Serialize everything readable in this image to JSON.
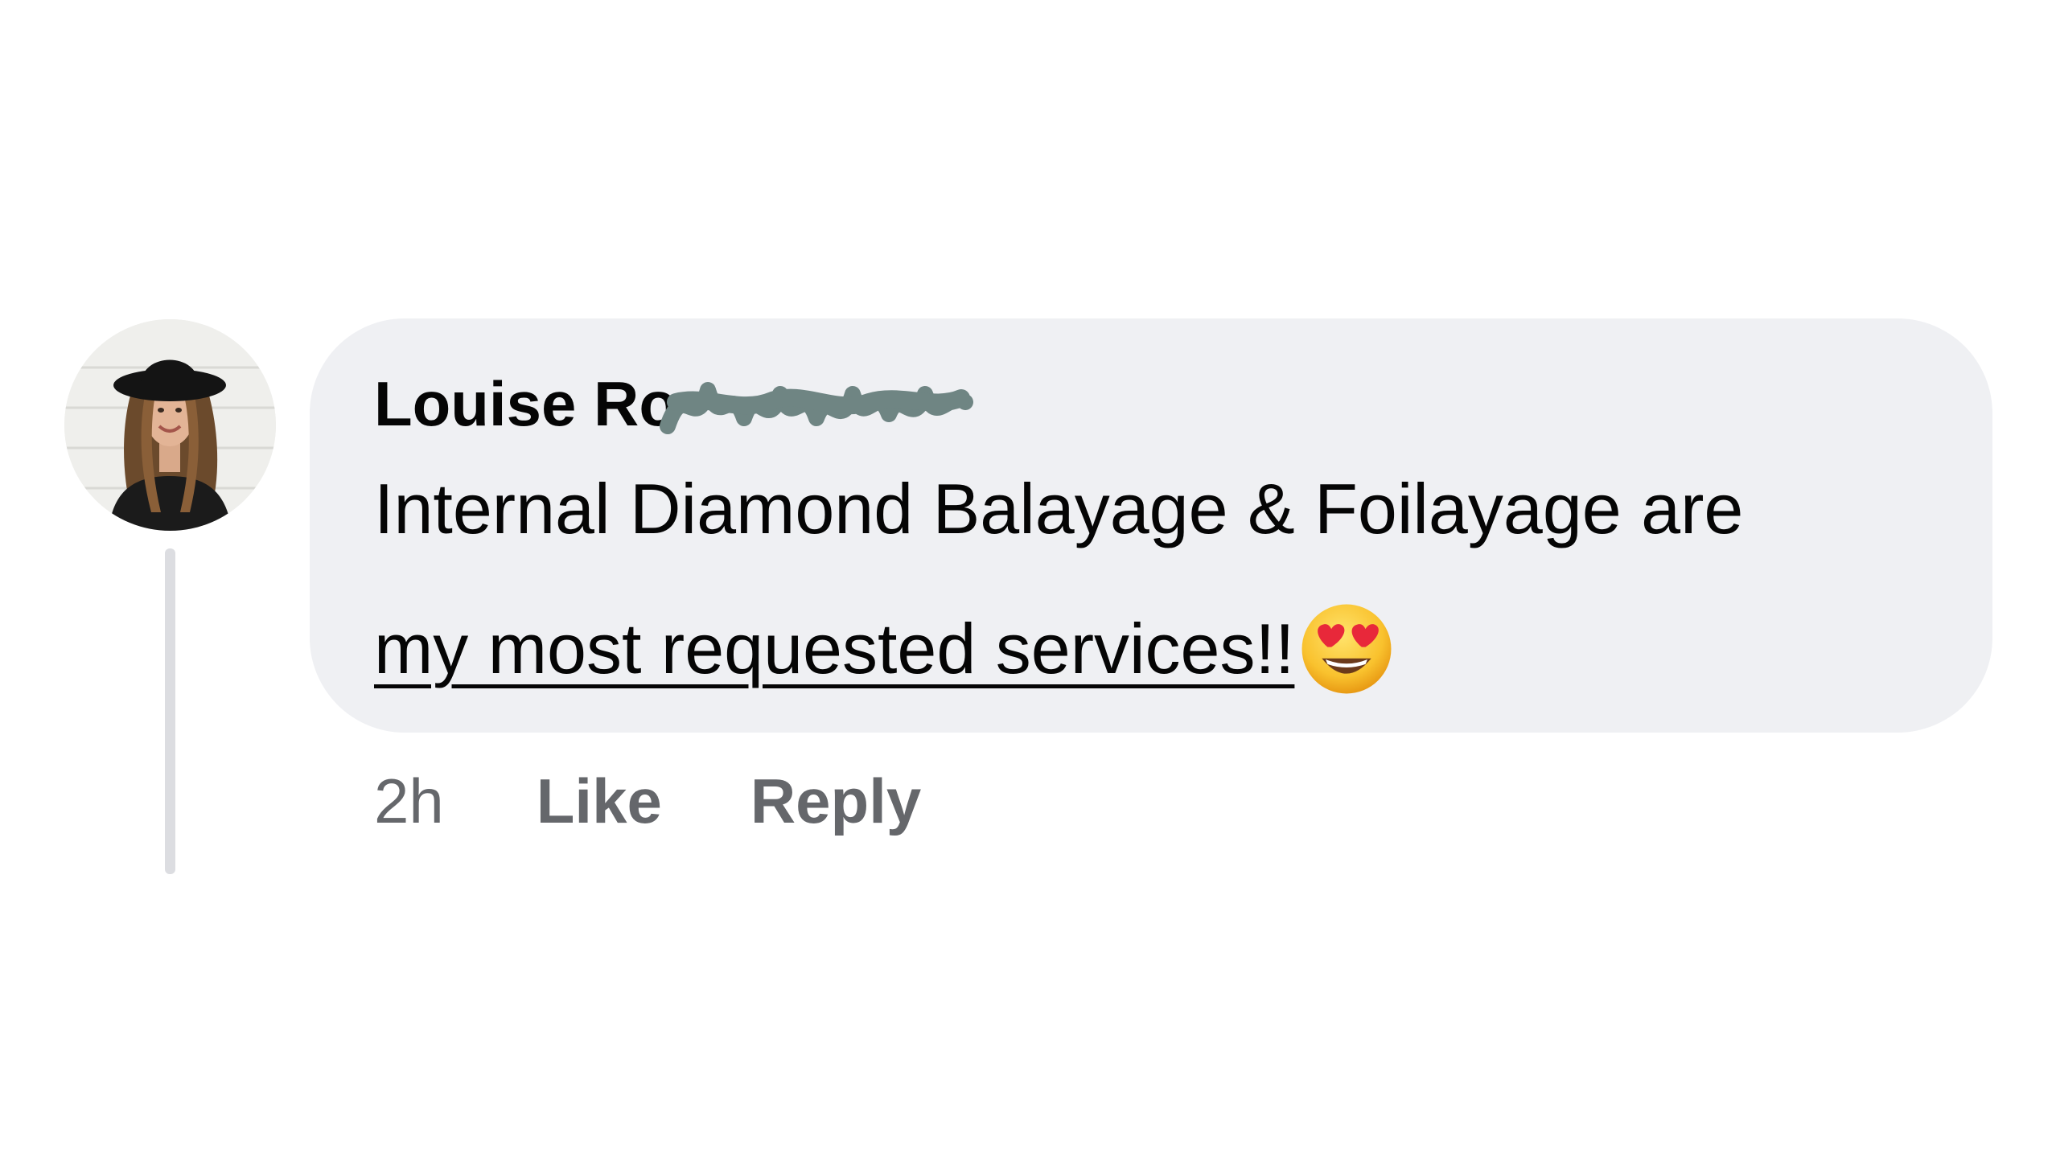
{
  "comment": {
    "author_name": "Louise Ro",
    "text_line1": "Internal Diamond Balayage & Foilayage are",
    "text_line2_link": "my most requested services!!",
    "emoji": "smiling-face-with-heart-eyes",
    "timestamp": "2h",
    "like_label": "Like",
    "reply_label": "Reply"
  },
  "colors": {
    "bubble_background": "#eff0f3",
    "text_primary": "#050505",
    "text_secondary": "#65676b",
    "thread_line": "#dcdde1"
  }
}
